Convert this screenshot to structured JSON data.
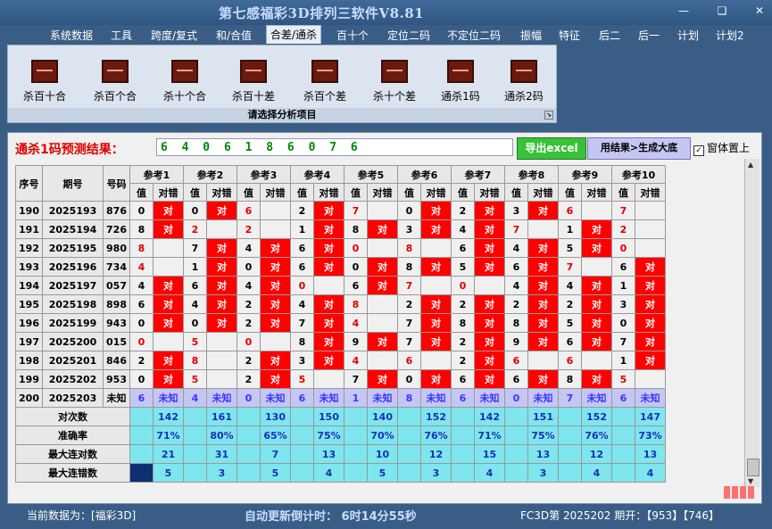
{
  "app": {
    "title": "第七感福彩3D排列三软件V8.81",
    "window_controls": [
      "minimize-icon",
      "restore-icon",
      "close-icon"
    ]
  },
  "menu": [
    "系统数据",
    "工具",
    "跨度/复式",
    "和/合值",
    "合差/通杀",
    "百十个",
    "定位二码",
    "不定位二码",
    "振幅",
    "特征",
    "后二",
    "后一",
    "计划",
    "计划2"
  ],
  "menu_active_index": 4,
  "ribbon": {
    "buttons": [
      "杀百十合",
      "杀百个合",
      "杀十个合",
      "杀百十差",
      "杀百个差",
      "杀十个差",
      "通杀1码",
      "通杀2码"
    ],
    "caption": "请选择分析项目"
  },
  "prediction": {
    "label": "通杀1码预测结果：",
    "value": "6 4 0 6 1 8 6 0 7 6"
  },
  "buttons": {
    "excel": "导出excel",
    "generate": "用结果>生成大底",
    "ontop_label": "窗体置上",
    "ontop_checked": true
  },
  "table": {
    "headers": {
      "seq": "序号",
      "period": "期号",
      "number": "号码",
      "refs": [
        "参考1",
        "参考2",
        "参考3",
        "参考4",
        "参考5",
        "参考6",
        "参考7",
        "参考8",
        "参考9",
        "参考10"
      ],
      "sub_value": "值",
      "sub_result": "对错"
    },
    "hit_text": "对",
    "rows": [
      {
        "seq": "190",
        "period": "2025193",
        "num": "876",
        "refs": [
          [
            "0",
            1,
            0
          ],
          [
            "0",
            1,
            0
          ],
          [
            "6",
            0,
            1
          ],
          [
            "2",
            1,
            0
          ],
          [
            "7",
            0,
            1
          ],
          [
            "0",
            1,
            0
          ],
          [
            "2",
            1,
            0
          ],
          [
            "3",
            1,
            0
          ],
          [
            "6",
            0,
            1
          ],
          [
            "7",
            0,
            1
          ]
        ]
      },
      {
        "seq": "191",
        "period": "2025194",
        "num": "726",
        "refs": [
          [
            "8",
            1,
            0
          ],
          [
            "2",
            0,
            1
          ],
          [
            "2",
            0,
            1
          ],
          [
            "1",
            1,
            0
          ],
          [
            "8",
            1,
            0
          ],
          [
            "3",
            1,
            0
          ],
          [
            "4",
            1,
            0
          ],
          [
            "7",
            0,
            1
          ],
          [
            "1",
            1,
            0
          ],
          [
            "2",
            0,
            1
          ]
        ]
      },
      {
        "seq": "192",
        "period": "2025195",
        "num": "980",
        "refs": [
          [
            "8",
            0,
            1
          ],
          [
            "7",
            1,
            0
          ],
          [
            "4",
            1,
            0
          ],
          [
            "6",
            1,
            0
          ],
          [
            "0",
            0,
            1
          ],
          [
            "8",
            0,
            1
          ],
          [
            "6",
            1,
            0
          ],
          [
            "4",
            1,
            0
          ],
          [
            "5",
            1,
            0
          ],
          [
            "0",
            0,
            1
          ]
        ]
      },
      {
        "seq": "193",
        "period": "2025196",
        "num": "734",
        "refs": [
          [
            "4",
            0,
            1
          ],
          [
            "1",
            1,
            0
          ],
          [
            "0",
            1,
            0
          ],
          [
            "6",
            1,
            0
          ],
          [
            "0",
            1,
            0
          ],
          [
            "8",
            1,
            0
          ],
          [
            "5",
            1,
            0
          ],
          [
            "6",
            1,
            0
          ],
          [
            "7",
            0,
            1
          ],
          [
            "6",
            1,
            0
          ]
        ]
      },
      {
        "seq": "194",
        "period": "2025197",
        "num": "057",
        "refs": [
          [
            "4",
            1,
            0
          ],
          [
            "6",
            1,
            0
          ],
          [
            "4",
            1,
            0
          ],
          [
            "0",
            0,
            1
          ],
          [
            "6",
            1,
            0
          ],
          [
            "7",
            0,
            1
          ],
          [
            "0",
            0,
            1
          ],
          [
            "4",
            1,
            0
          ],
          [
            "4",
            1,
            0
          ],
          [
            "1",
            1,
            0
          ]
        ]
      },
      {
        "seq": "195",
        "period": "2025198",
        "num": "898",
        "refs": [
          [
            "6",
            1,
            0
          ],
          [
            "4",
            1,
            0
          ],
          [
            "2",
            1,
            0
          ],
          [
            "4",
            1,
            0
          ],
          [
            "8",
            0,
            1
          ],
          [
            "2",
            1,
            0
          ],
          [
            "2",
            1,
            0
          ],
          [
            "2",
            1,
            0
          ],
          [
            "2",
            1,
            0
          ],
          [
            "3",
            1,
            0
          ]
        ]
      },
      {
        "seq": "196",
        "period": "2025199",
        "num": "943",
        "refs": [
          [
            "0",
            1,
            0
          ],
          [
            "0",
            1,
            0
          ],
          [
            "2",
            1,
            0
          ],
          [
            "7",
            1,
            0
          ],
          [
            "4",
            0,
            1
          ],
          [
            "7",
            1,
            0
          ],
          [
            "8",
            1,
            0
          ],
          [
            "8",
            1,
            0
          ],
          [
            "5",
            1,
            0
          ],
          [
            "0",
            1,
            0
          ]
        ]
      },
      {
        "seq": "197",
        "period": "2025200",
        "num": "015",
        "refs": [
          [
            "0",
            0,
            1
          ],
          [
            "5",
            0,
            1
          ],
          [
            "0",
            0,
            1
          ],
          [
            "8",
            1,
            0
          ],
          [
            "9",
            1,
            0
          ],
          [
            "7",
            1,
            0
          ],
          [
            "2",
            1,
            0
          ],
          [
            "9",
            1,
            0
          ],
          [
            "6",
            1,
            0
          ],
          [
            "7",
            1,
            0
          ]
        ]
      },
      {
        "seq": "198",
        "period": "2025201",
        "num": "846",
        "refs": [
          [
            "2",
            1,
            0
          ],
          [
            "8",
            0,
            1
          ],
          [
            "2",
            1,
            0
          ],
          [
            "3",
            1,
            0
          ],
          [
            "4",
            0,
            1
          ],
          [
            "6",
            0,
            1
          ],
          [
            "2",
            1,
            0
          ],
          [
            "6",
            0,
            1
          ],
          [
            "6",
            0,
            1
          ],
          [
            "1",
            1,
            0
          ]
        ]
      },
      {
        "seq": "199",
        "period": "2025202",
        "num": "953",
        "refs": [
          [
            "0",
            1,
            0
          ],
          [
            "5",
            0,
            1
          ],
          [
            "2",
            1,
            0
          ],
          [
            "5",
            0,
            1
          ],
          [
            "7",
            1,
            0
          ],
          [
            "0",
            1,
            0
          ],
          [
            "6",
            1,
            0
          ],
          [
            "6",
            1,
            0
          ],
          [
            "8",
            1,
            0
          ],
          [
            "5",
            0,
            1
          ]
        ]
      }
    ],
    "future_row": {
      "seq": "200",
      "period": "2025203",
      "num": "未知",
      "values": [
        "6",
        "4",
        "0",
        "6",
        "1",
        "8",
        "6",
        "0",
        "7",
        "6"
      ],
      "status": "未知"
    },
    "stats": [
      {
        "label": "对次数",
        "values": [
          "142",
          "161",
          "130",
          "150",
          "140",
          "152",
          "142",
          "151",
          "152",
          "147"
        ]
      },
      {
        "label": "准确率",
        "values": [
          "71%",
          "80%",
          "65%",
          "75%",
          "70%",
          "76%",
          "71%",
          "75%",
          "76%",
          "73%"
        ]
      },
      {
        "label": "最大连对数",
        "values": [
          "21",
          "31",
          "7",
          "13",
          "10",
          "12",
          "15",
          "13",
          "12",
          "13"
        ]
      },
      {
        "label": "最大连错数",
        "values": [
          "5",
          "3",
          "5",
          "4",
          "5",
          "3",
          "4",
          "3",
          "4",
          "4"
        ]
      }
    ]
  },
  "status": {
    "data_source": "当前数据为：[福彩3D]",
    "countdown": "自动更新倒计时： 6时14分55秒",
    "latest": "FC3D第 2025202 期开：【953】【746】"
  },
  "colors": {
    "accent_red": "#ff0000",
    "future_row": "#c6c6f5",
    "stat_row": "#7fe5ee",
    "excel_green": "#39c239",
    "background": "#3a5d86"
  }
}
